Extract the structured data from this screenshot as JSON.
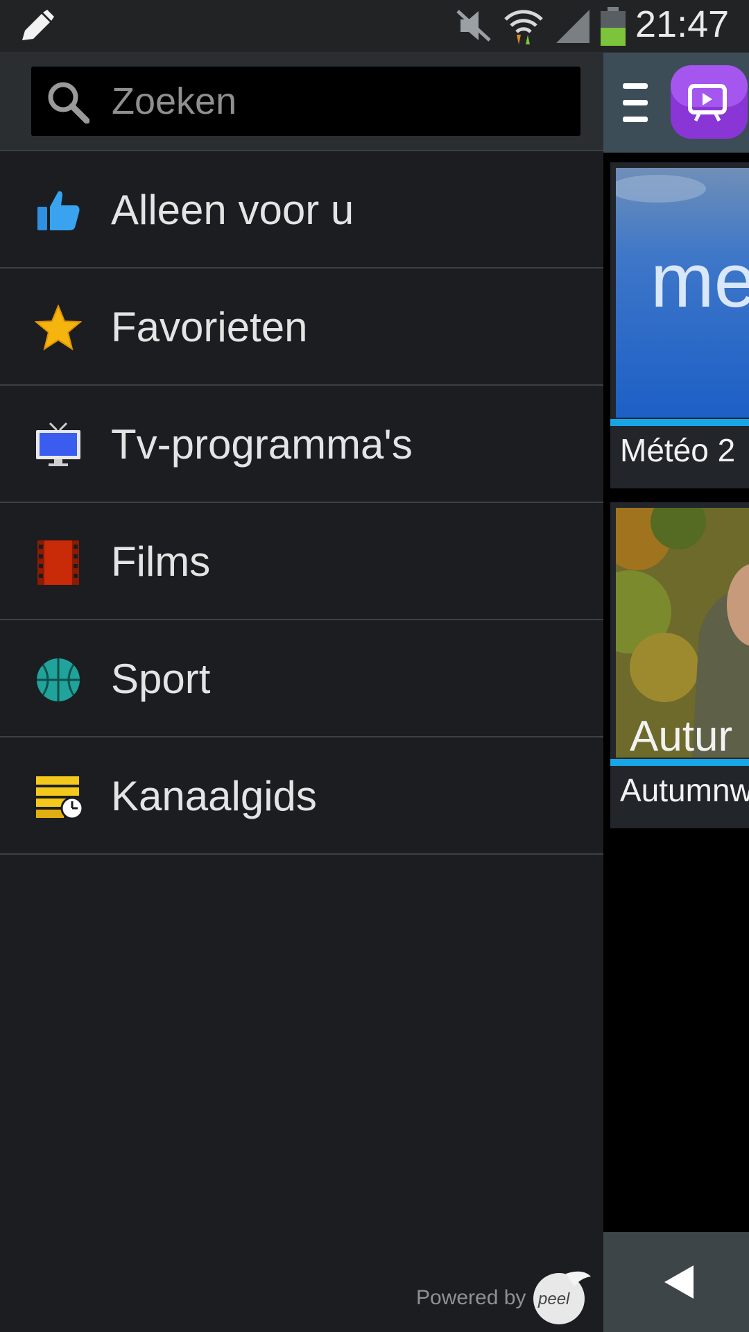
{
  "status_bar": {
    "time": "21:47",
    "icons": [
      "pencil-icon",
      "mute-icon",
      "wifi-icon",
      "signal-icon",
      "battery-icon"
    ]
  },
  "search": {
    "placeholder": "Zoeken"
  },
  "menu": {
    "items": [
      {
        "label": "Alleen voor u",
        "icon": "thumbs-up-icon"
      },
      {
        "label": "Favorieten",
        "icon": "star-icon"
      },
      {
        "label": "Tv-programma's",
        "icon": "tv-icon"
      },
      {
        "label": "Films",
        "icon": "film-icon"
      },
      {
        "label": "Sport",
        "icon": "basketball-icon"
      },
      {
        "label": "Kanaalgids",
        "icon": "channel-guide-icon"
      }
    ]
  },
  "footer": {
    "powered_by": "Powered by",
    "logo_text": "peel"
  },
  "main": {
    "cards": [
      {
        "title": "Météo 2",
        "thumb_text": "me"
      },
      {
        "title": "Autumnw",
        "thumb_text": "Autur"
      }
    ]
  },
  "colors": {
    "accent": "#17a6e8",
    "drawer_bg": "#1b1d20",
    "app_icon": "#9b3fe0"
  }
}
